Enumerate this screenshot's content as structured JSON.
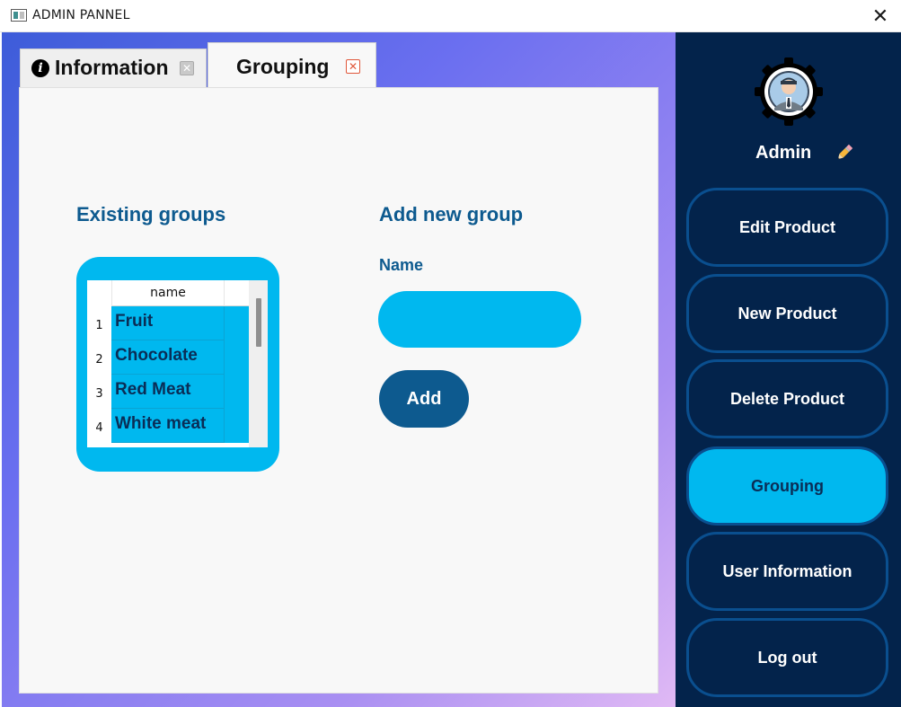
{
  "window": {
    "title": "ADMIN PANNEL",
    "close_glyph": "✕"
  },
  "tabs": [
    {
      "label": "Information",
      "icon": "info-icon",
      "close_glyph": "✕",
      "active": false
    },
    {
      "label": "Grouping",
      "close_glyph": "✕",
      "active": true
    }
  ],
  "existing_groups": {
    "heading": "Existing groups",
    "column_header": "name",
    "rows": [
      {
        "num": "1",
        "name": "Fruit"
      },
      {
        "num": "2",
        "name": "Chocolate"
      },
      {
        "num": "3",
        "name": "Red Meat"
      },
      {
        "num": "4",
        "name": "White meat"
      }
    ]
  },
  "add_group": {
    "heading": "Add new group",
    "name_label": "Name",
    "name_value": "",
    "add_label": "Add"
  },
  "sidebar": {
    "user_name": "Admin",
    "avatar_icon": "admin-avatar-gear-icon",
    "edit_icon": "pencil-icon",
    "items": [
      {
        "label": "Edit Product",
        "active": false
      },
      {
        "label": "New Product",
        "active": false
      },
      {
        "label": "Delete Product",
        "active": false
      },
      {
        "label": "Grouping",
        "active": true
      },
      {
        "label": "User Information",
        "active": false
      },
      {
        "label": "Log out",
        "active": false
      }
    ]
  },
  "colors": {
    "sidebar_bg": "#03234b",
    "accent_cyan": "#00b8ef",
    "heading_blue": "#0d5a8f",
    "button_border": "#0a4f8f"
  }
}
